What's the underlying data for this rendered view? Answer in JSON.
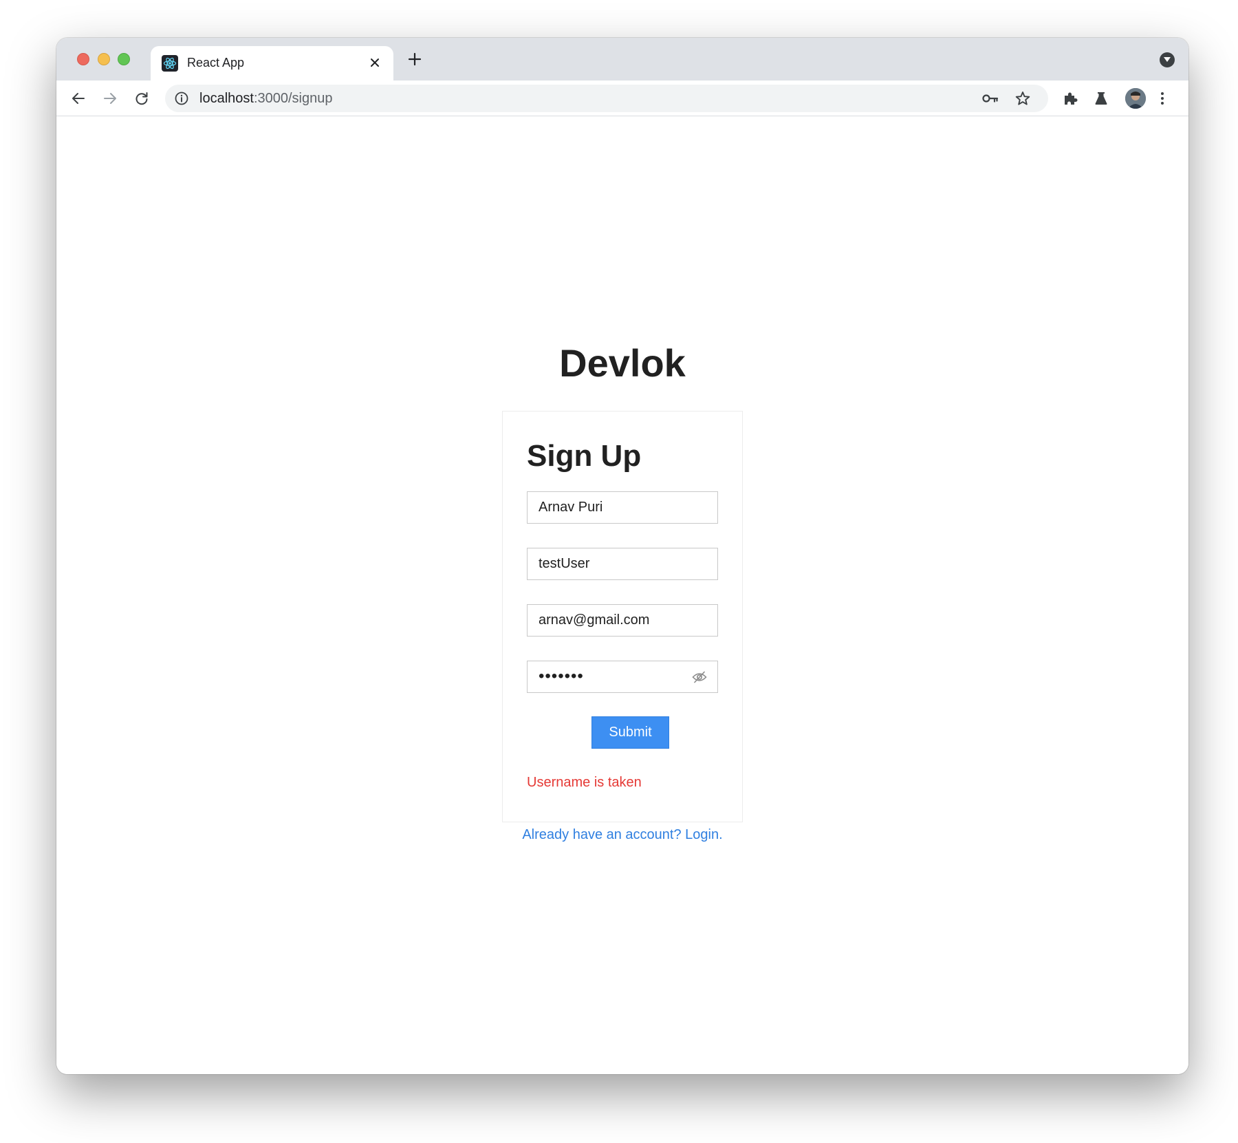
{
  "browser": {
    "tab": {
      "title": "React App",
      "favicon": "react-logo-icon"
    },
    "address": {
      "host": "localhost",
      "path": ":3000/signup"
    },
    "icons": {
      "back": "arrow-left-icon",
      "forward": "arrow-right-icon",
      "reload": "reload-icon",
      "info": "info-icon",
      "key": "key-icon",
      "bookmark": "star-icon",
      "extensions": "puzzle-icon",
      "labs": "flask-icon",
      "menu": "kebab-menu-icon"
    }
  },
  "page": {
    "brand": "Devlok",
    "form": {
      "title": "Sign Up",
      "name_value": "Arnav Puri",
      "username_value": "testUser",
      "email_value": "arnav@gmail.com",
      "password_mask": "•••••••",
      "submit_label": "Submit",
      "error": "Username is taken"
    },
    "login_link": "Already have an account? Login."
  },
  "colors": {
    "accent": "#3d8ff2",
    "link": "#2f7fe0",
    "error": "#e53935",
    "text": "#212121"
  }
}
